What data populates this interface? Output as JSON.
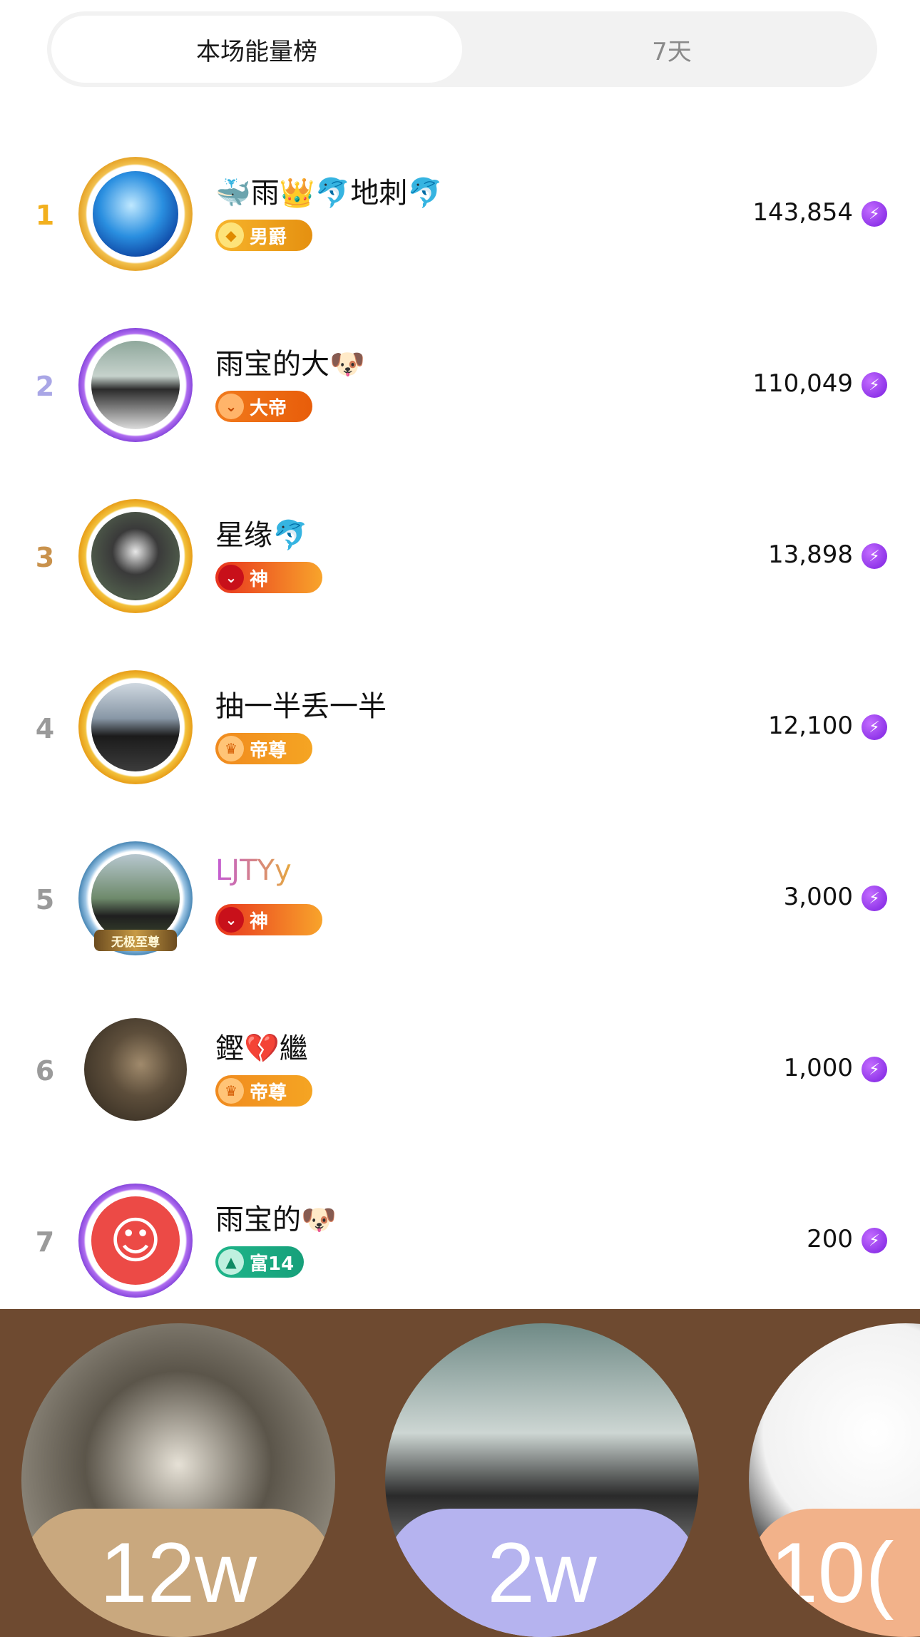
{
  "tabs": [
    {
      "label": "本场能量榜",
      "active": true
    },
    {
      "label": "7天",
      "active": false
    }
  ],
  "rows": [
    {
      "rank": "1",
      "name": "🐳雨👑🐬地刺🐬",
      "badge": "男爵",
      "score": "143,854"
    },
    {
      "rank": "2",
      "name": "雨宝的大🐶",
      "badge": "大帝",
      "score": "110,049"
    },
    {
      "rank": "3",
      "name": "星缘🐬",
      "badge": "神",
      "score": "13,898"
    },
    {
      "rank": "4",
      "name": "抽一半丢一半",
      "badge": "帝尊",
      "score": "12,100"
    },
    {
      "rank": "5",
      "name": "LJTYy",
      "badge": "神",
      "score": "3,000"
    },
    {
      "rank": "6",
      "name": "鏗💔繼",
      "badge": "帝尊",
      "score": "1,000"
    },
    {
      "rank": "7",
      "name": "雨宝的🐶",
      "badge": "富14",
      "score": "200"
    }
  ],
  "frame_label_5": "无极至尊",
  "bottom": [
    {
      "label": "12w"
    },
    {
      "label": "2w"
    },
    {
      "label": "10("
    }
  ],
  "colors": {
    "rank1": "#f2b01e",
    "rank2": "#a9a6e6",
    "rank3": "#c9924c",
    "rank_other": "#9a9a9a",
    "energy": "#8a2be2"
  },
  "icons": {
    "energy": "lightning-bolt-icon"
  }
}
